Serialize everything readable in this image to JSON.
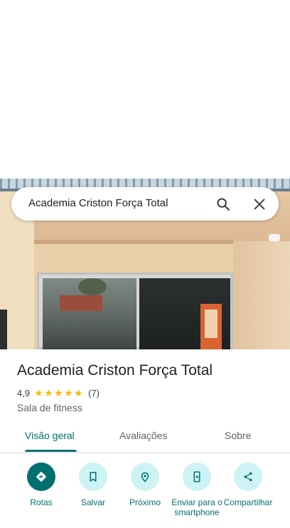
{
  "search": {
    "query": "Academia Criston Força Total"
  },
  "place": {
    "name": "Academia Criston Força Total",
    "rating": "4,9",
    "stars": 5,
    "review_count": "(7)",
    "category": "Sala de fitness"
  },
  "tabs": [
    {
      "label": "Visão geral",
      "active": true
    },
    {
      "label": "Avaliações",
      "active": false
    },
    {
      "label": "Sobre",
      "active": false
    }
  ],
  "actions": [
    {
      "label": "Rotas",
      "icon": "directions-icon"
    },
    {
      "label": "Salvar",
      "icon": "bookmark-icon"
    },
    {
      "label": "Próximo",
      "icon": "nearby-icon"
    },
    {
      "label": "Enviar para o smartphone",
      "icon": "send-to-phone-icon"
    },
    {
      "label": "Compartilhar",
      "icon": "share-icon"
    }
  ],
  "colors": {
    "accent": "#00706f",
    "accent_light": "#cdf3f5",
    "star": "#fbbc04"
  }
}
